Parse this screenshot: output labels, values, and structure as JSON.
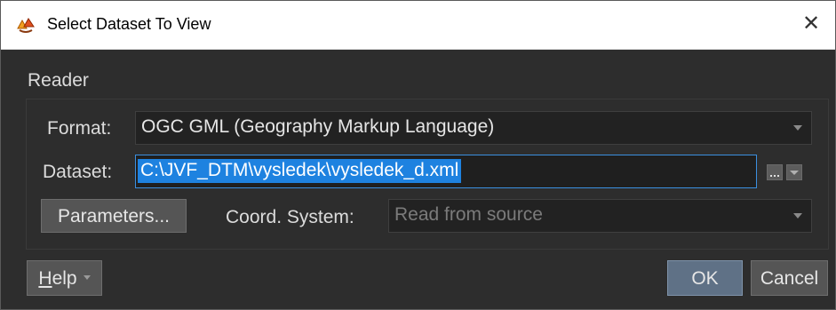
{
  "window": {
    "title": "Select Dataset To View",
    "app_icon": "fme-reader-icon",
    "close_glyph": "✕"
  },
  "reader": {
    "group_label": "Reader",
    "format_label": "Format:",
    "format_value": "OGC GML (Geography Markup Language)",
    "dataset_label": "Dataset:",
    "dataset_value": "C:\\JVF_DTM\\vysledek\\vysledek_d.xml",
    "parameters_button": "Parameters...",
    "coord_label": "Coord. System:",
    "coord_placeholder": "Read from source"
  },
  "footer": {
    "help_prefix": "H",
    "help_rest": "elp",
    "ok_label": "OK",
    "cancel_label": "Cancel"
  },
  "colors": {
    "background": "#2d2d2d",
    "selection": "#1e82e0",
    "ok_button": "#5f7186"
  }
}
